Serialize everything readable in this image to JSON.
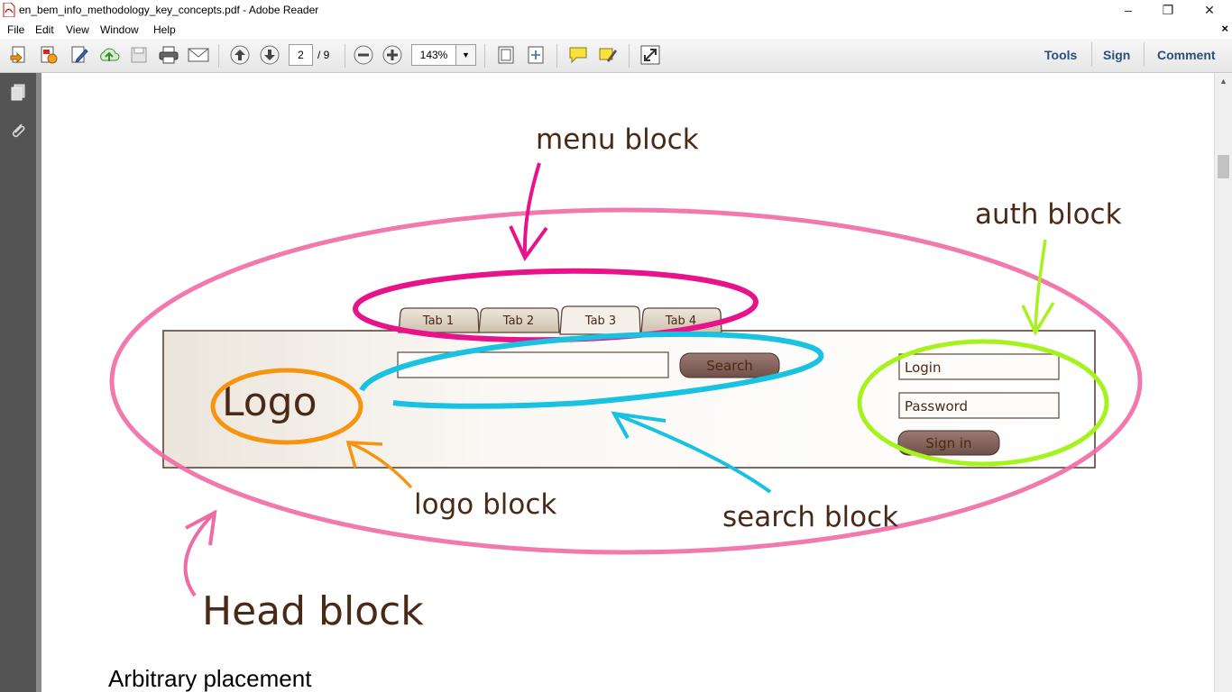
{
  "window": {
    "title": "en_bem_info_methodology_key_concepts.pdf - Adobe Reader",
    "minimize_label": "–",
    "restore_label": "❐",
    "close_label": "✕"
  },
  "menu": {
    "items": [
      "File",
      "Edit",
      "View",
      "Window",
      "Help"
    ],
    "close_doc_label": "×"
  },
  "toolbar": {
    "page_current": "2",
    "page_total": "/ 9",
    "zoom": "143%",
    "tools_label": "Tools",
    "sign_label": "Sign",
    "comment_label": "Comment"
  },
  "diagram": {
    "menu_block_label": "menu block",
    "auth_block_label": "auth block",
    "logo_block_label": "logo block",
    "search_block_label": "search block",
    "head_block_label": "Head block",
    "tabs": [
      "Tab 1",
      "Tab 2",
      "Tab 3",
      "Tab 4"
    ],
    "logo_text": "Logo",
    "search_button": "Search",
    "login_placeholder": "Login",
    "password_placeholder": "Password",
    "signin_button": "Sign in",
    "colors": {
      "head": "#f06aa3",
      "menu": "#e8128a",
      "search": "#19c2e0",
      "logo": "#f7940f",
      "auth": "#a6f21c",
      "ink": "#4a2a17"
    }
  },
  "page_text": {
    "heading": "Arbitrary placement"
  }
}
